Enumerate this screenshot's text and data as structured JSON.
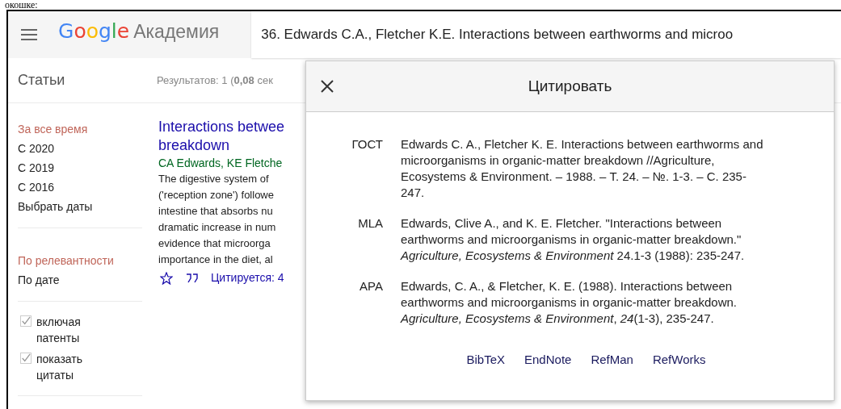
{
  "document_text": "окошке:",
  "header": {
    "logo": {
      "brand": "Google",
      "product": "Академия"
    },
    "search": {
      "value": "36. Edwards C.A., Fletcher K.E. Interactions between earthworms and microo"
    }
  },
  "subheader": {
    "section": "Статьи",
    "results": "Результатов: 1 (**0,08** сек"
  },
  "sidebar": {
    "time_filters": [
      {
        "label": "За все время",
        "selected": true
      },
      {
        "label": "С 2020",
        "selected": false
      },
      {
        "label": "С 2019",
        "selected": false
      },
      {
        "label": "С 2016",
        "selected": false
      },
      {
        "label": "Выбрать даты",
        "selected": false
      }
    ],
    "sort": [
      {
        "label": "По релевантности",
        "selected": true
      },
      {
        "label": "По дате",
        "selected": false
      }
    ],
    "options": [
      {
        "label": "включая патенты",
        "checked": true
      },
      {
        "label": "показать цитаты",
        "checked": true
      }
    ]
  },
  "result": {
    "title_lines": [
      "Interactions betwee",
      "breakdown"
    ],
    "authors": "CA Edwards, KE Fletche",
    "snippet_lines": [
      "The digestive system of",
      "('reception zone') followe",
      "intestine that absorbs nu",
      "dramatic increase in num",
      "evidence that microorga",
      "importance in the diet, al"
    ],
    "actions": {
      "cited_by": "Цитируется: 4"
    }
  },
  "cite_dialog": {
    "title": "Цитировать",
    "citations": [
      {
        "style": "ГОСТ",
        "text": "Edwards C. A., Fletcher K. E. Interactions between earthworms and microorganisms in organic-matter breakdown //Agriculture, Ecosystems & Environment. – 1988. – Т. 24. – №. 1-3. – С. 235-247."
      },
      {
        "style": "MLA",
        "text": "Edwards, Clive A., and K. E. Fletcher. \"Interactions between earthworms and microorganisms in organic-matter breakdown.\" *Agriculture, Ecosystems & Environment* 24.1-3 (1988): 235-247."
      },
      {
        "style": "APA",
        "text": "Edwards, C. A., & Fletcher, K. E. (1988). Interactions between earthworms and microorganisms in organic-matter breakdown. *Agriculture, Ecosystems & Environment*, *24*(1-3), 235-247."
      }
    ],
    "export_links": [
      "BibTeX",
      "EndNote",
      "RefMan",
      "RefWorks"
    ]
  }
}
